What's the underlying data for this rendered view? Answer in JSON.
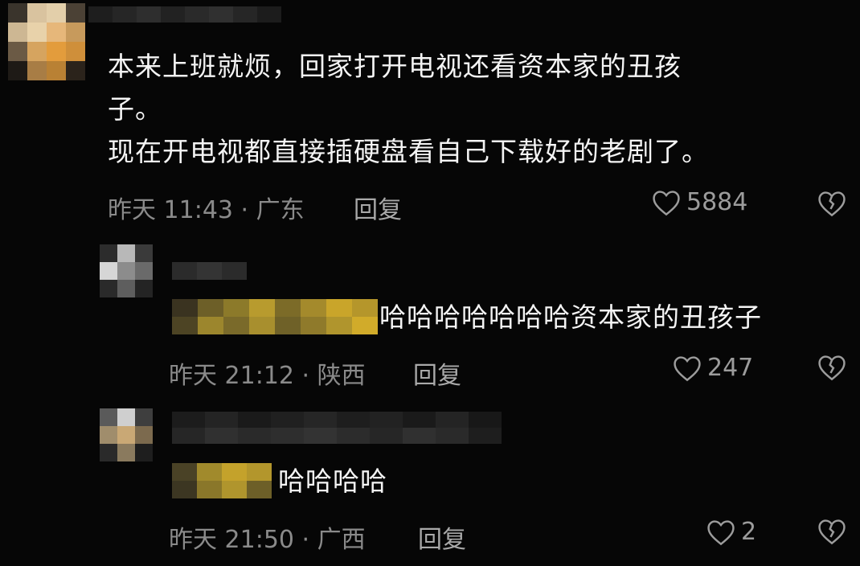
{
  "comments": [
    {
      "lines": [
        "本来上班就烦，回家打开电视还看资本家的丑孩",
        "子。",
        "现在开电视都直接插硬盘看自己下载好的老剧了。"
      ],
      "time": "昨天 11:43 · 广东",
      "reply_label": "回复",
      "likes": "5884"
    },
    {
      "text": "哈哈哈哈哈哈哈资本家的丑孩子",
      "time": "昨天 21:12 · 陕西",
      "reply_label": "回复",
      "likes": "247"
    },
    {
      "text": "哈哈哈哈",
      "time": "昨天 21:50 · 广西",
      "reply_label": "回复",
      "likes": "2"
    }
  ],
  "icons": {
    "like": "heart-outline-icon",
    "dislike": "broken-heart-icon"
  },
  "colors": {
    "background": "#060606",
    "text": "#f4f4f4",
    "meta": "#8a8a8a",
    "quote_blur": "#c9a52a"
  }
}
